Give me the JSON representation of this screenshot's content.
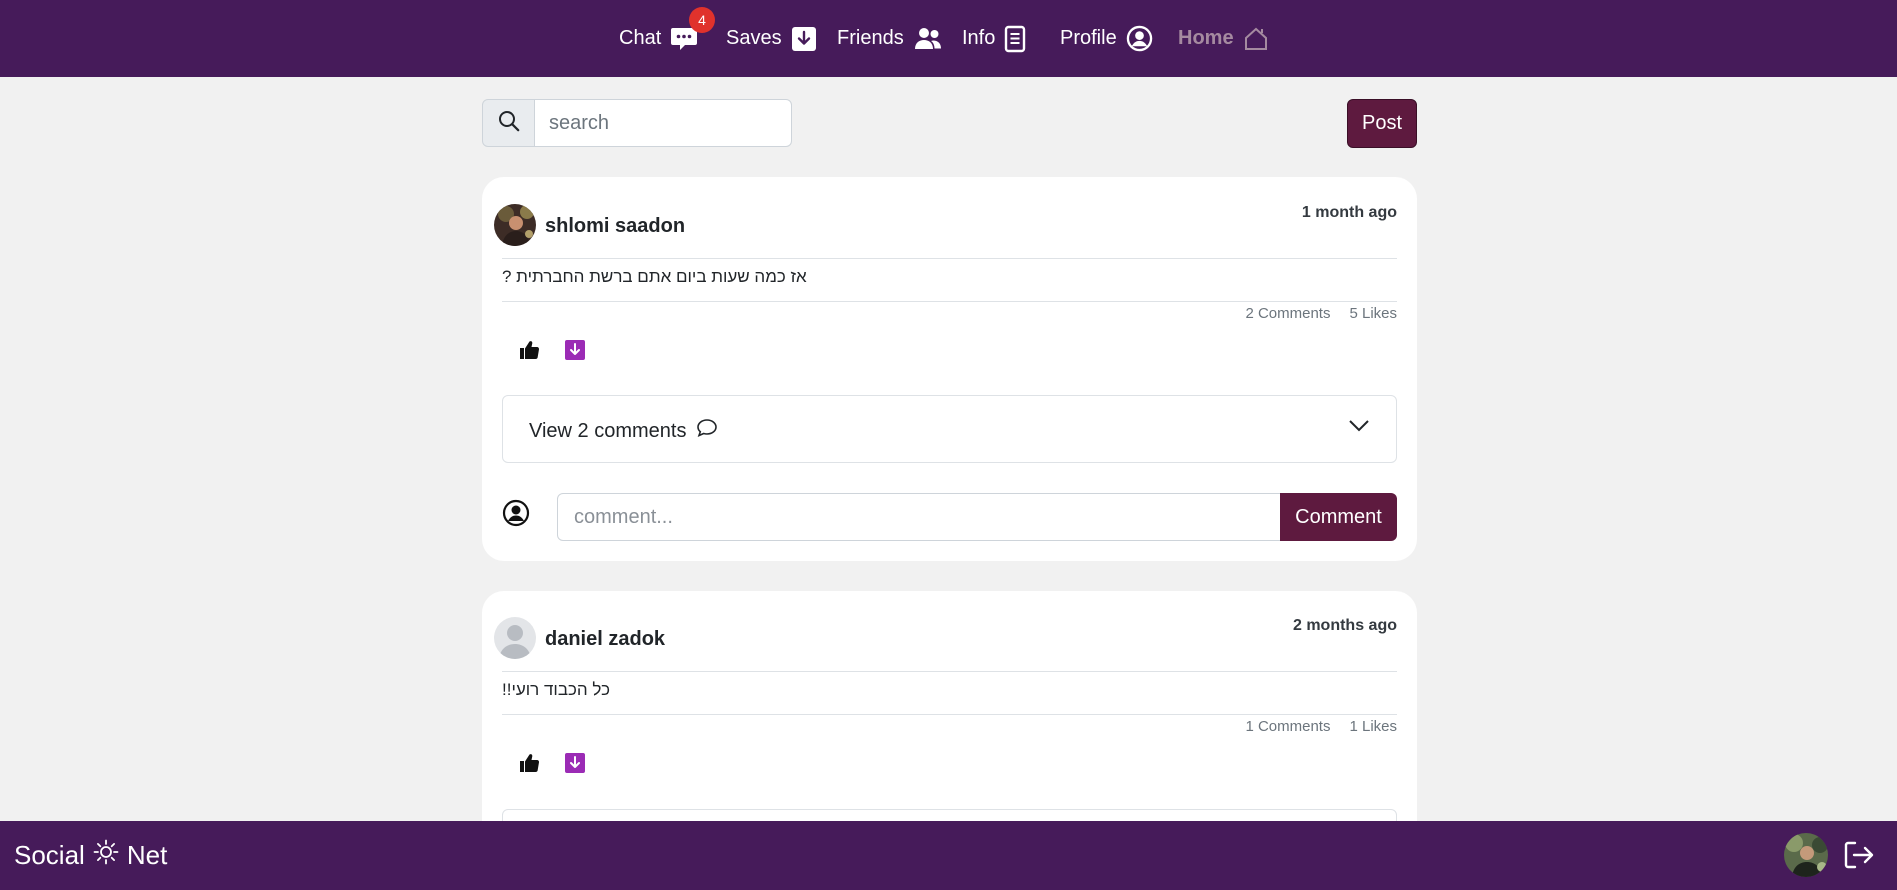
{
  "nav": {
    "chat": "Chat",
    "chat_badge": "4",
    "saves": "Saves",
    "friends": "Friends",
    "info": "Info",
    "profile": "Profile",
    "home": "Home"
  },
  "search": {
    "placeholder": "search"
  },
  "post_button": "Post",
  "posts": [
    {
      "author": "shlomi saadon",
      "time": "1 month ago",
      "text": "אז כמה שעות ביום אתם ברשת החברתית ?",
      "comments_count": "2 Comments",
      "likes_count": "5 Likes",
      "view_comments": "View 2 comments",
      "comment_placeholder": "comment...",
      "comment_button": "Comment"
    },
    {
      "author": "daniel zadok",
      "time": "2 months ago",
      "text": "כל הכבוד רועי!!",
      "comments_count": "1 Comments",
      "likes_count": "1 Likes"
    }
  ],
  "footer": {
    "brand_left": "Social",
    "brand_right": "Net"
  },
  "colors": {
    "navbar": "#461b5a",
    "primary_button": "#5e1a3f",
    "badge": "#e0322c",
    "save_icon": "#9b2bb5",
    "home_inactive": "#a58aa0"
  },
  "icons": [
    "chat-icon",
    "download-icon",
    "friends-icon",
    "document-icon",
    "user-circle-icon",
    "house-icon",
    "search-icon",
    "thumbs-up-icon",
    "chat-bubble-icon",
    "chevron-down-icon",
    "sun-icon",
    "logout-icon"
  ]
}
